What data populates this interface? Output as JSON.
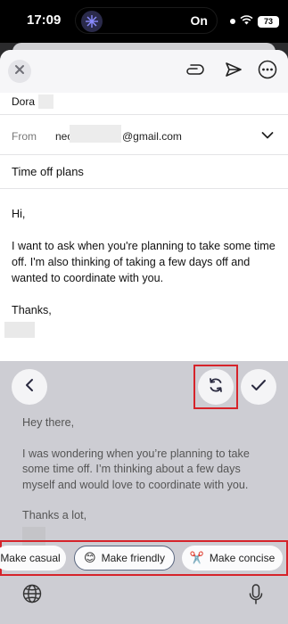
{
  "status_bar": {
    "time": "17:09",
    "island_text": "On",
    "battery": "73"
  },
  "compose": {
    "icons": [
      "close-icon",
      "paperclip-icon",
      "send-icon",
      "more-icon"
    ],
    "to_name": "Dora",
    "from_label": "From",
    "from_prefix": "neon",
    "from_suffix": "@gmail.com",
    "subject": "Time off plans",
    "body": {
      "greeting": "Hi,",
      "paragraph": "I want to ask when you're planning to take some time off. I'm also thinking of taking a few days off and wanted to coordinate with you.",
      "signoff": "Thanks,"
    }
  },
  "ai_panel": {
    "icons": [
      "back-chevron-icon",
      "refresh-icon",
      "checkmark-icon"
    ],
    "suggestion": {
      "greeting": "Hey there,",
      "paragraph": "I was wondering when you’re planning to take some time off. I’m thinking about a few days myself and would love to coordinate with you.",
      "signoff": "Thanks a lot,"
    },
    "chips": [
      {
        "label": "Make casual",
        "emoji": ""
      },
      {
        "label": "Make friendly",
        "emoji": "😊"
      },
      {
        "label": "Make concise",
        "emoji": "✂️"
      }
    ],
    "selected_chip": "Make friendly",
    "highlight_color": "#d6232a"
  },
  "keyboard": {
    "icons": [
      "globe-icon",
      "microphone-icon"
    ]
  }
}
